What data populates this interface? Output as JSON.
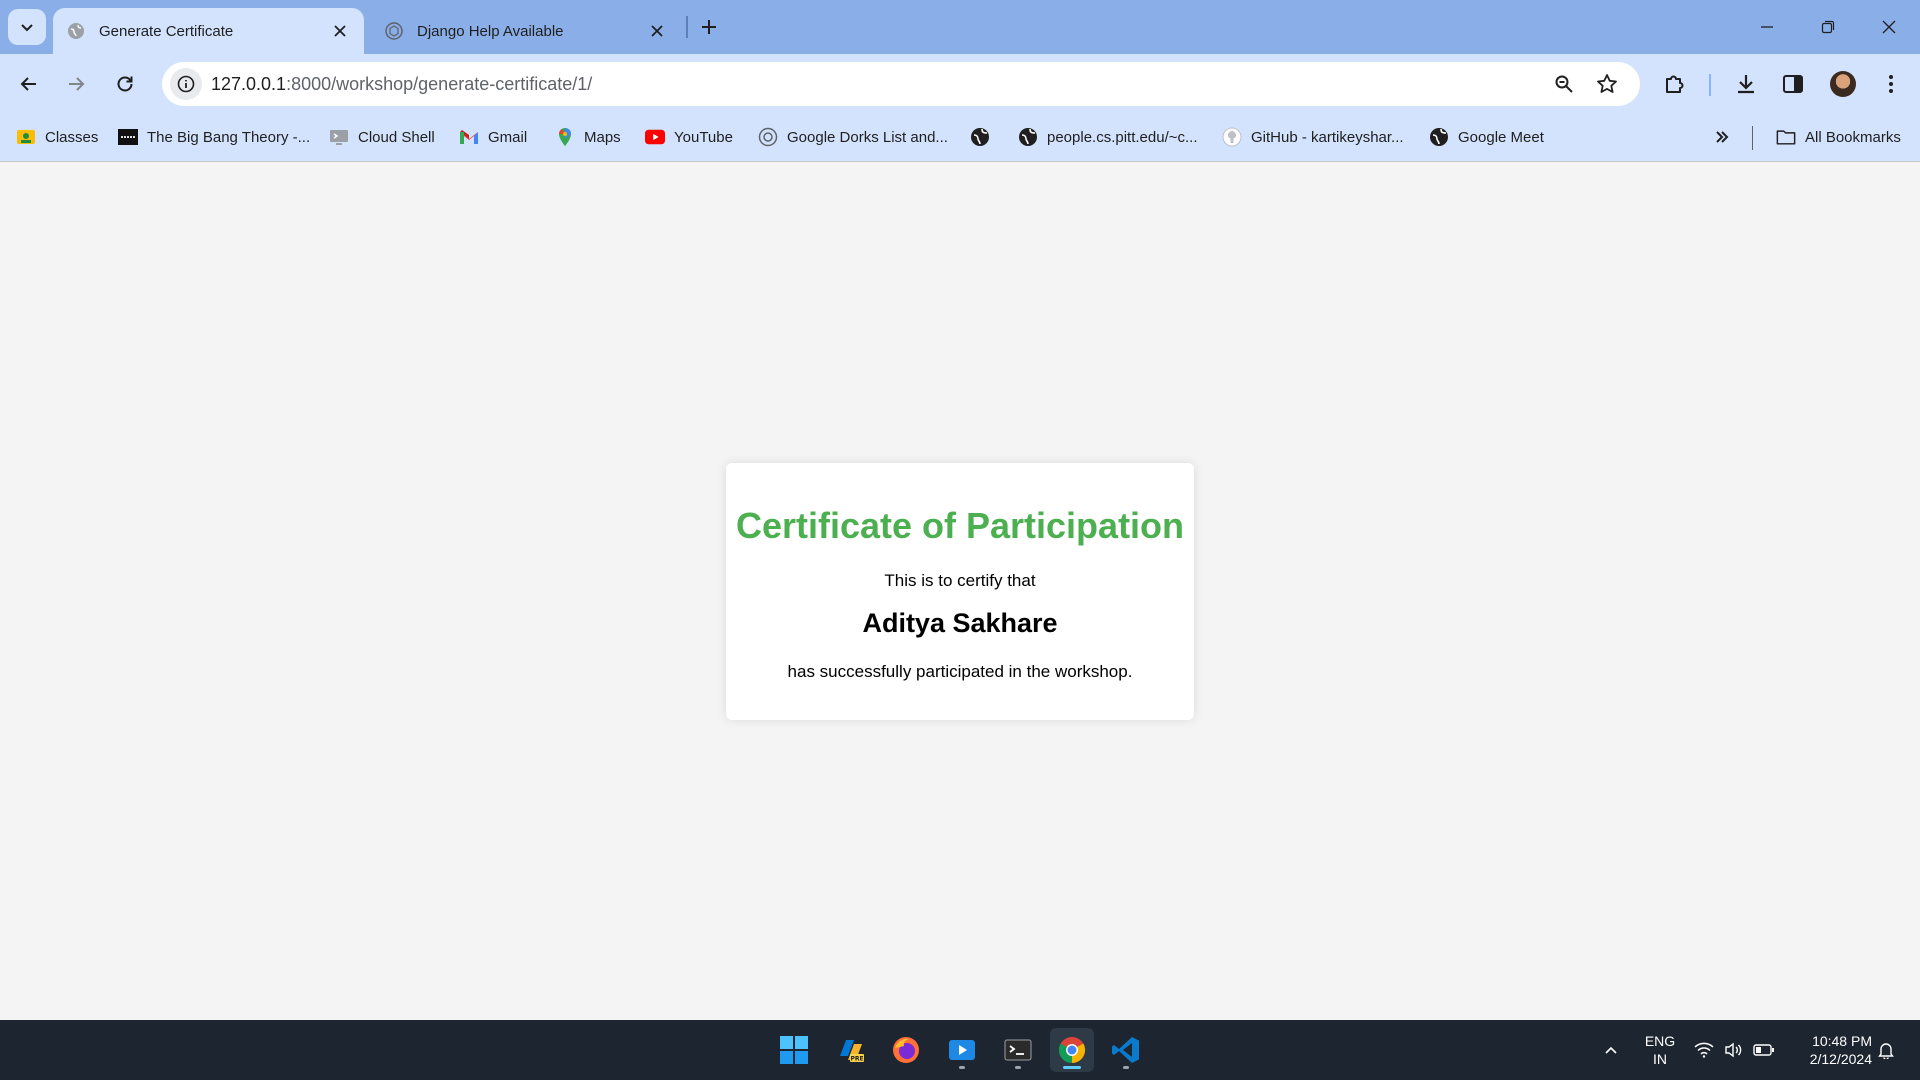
{
  "browser": {
    "tabs": [
      {
        "title": "Generate Certificate",
        "active": true,
        "favicon": "globe-icon"
      },
      {
        "title": "Django Help Available",
        "active": false,
        "favicon": "chatgpt-icon"
      }
    ],
    "url_host": "127.0.0.1",
    "url_path": ":8000/workshop/generate-certificate/1/",
    "bookmarks": [
      {
        "label": "Classes",
        "icon": "classroom-icon"
      },
      {
        "label": "The Big Bang Theory -...",
        "icon": "tv-icon"
      },
      {
        "label": "Cloud Shell",
        "icon": "cloud-shell-icon"
      },
      {
        "label": "Gmail",
        "icon": "gmail-icon"
      },
      {
        "label": "Maps",
        "icon": "maps-icon"
      },
      {
        "label": "YouTube",
        "icon": "youtube-icon"
      },
      {
        "label": "Google Dorks List and...",
        "icon": "google-dorks-icon"
      },
      {
        "label": "",
        "icon": "globe-icon"
      },
      {
        "label": "people.cs.pitt.edu/~c...",
        "icon": "globe-icon"
      },
      {
        "label": "GitHub - kartikeyshar...",
        "icon": "github-icon"
      },
      {
        "label": "Google Meet",
        "icon": "globe-icon"
      }
    ],
    "all_bookmarks_label": "All Bookmarks"
  },
  "certificate": {
    "title": "Certificate of Participation",
    "line1": "This is to certify that",
    "name": "Aditya Sakhare",
    "line2": "has successfully participated in the workshop.",
    "title_color": "#4caf50"
  },
  "taskbar": {
    "apps": [
      "windows-start-icon",
      "copilot-pre-icon",
      "firefox-icon",
      "media-player-icon",
      "terminal-icon",
      "chrome-icon",
      "vscode-icon"
    ],
    "lang_line1": "ENG",
    "lang_line2": "IN",
    "time": "10:48 PM",
    "date": "2/12/2024"
  }
}
